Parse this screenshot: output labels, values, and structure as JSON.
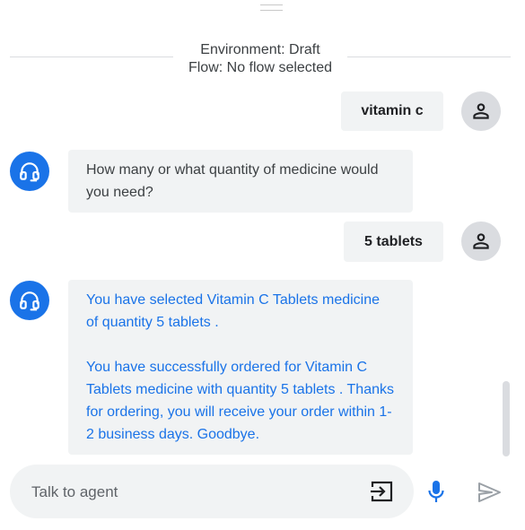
{
  "session": {
    "environment": "Environment: Draft",
    "flow": "Flow: No flow selected"
  },
  "messages": [
    {
      "role": "user",
      "paragraphs": [
        "vitamin c"
      ]
    },
    {
      "role": "agent",
      "paragraphs": [
        "How many or what quantity of medicine would you need?"
      ]
    },
    {
      "role": "user",
      "paragraphs": [
        "5 tablets"
      ]
    },
    {
      "role": "agent",
      "paragraphs": [
        "You have selected Vitamin C Tablets medicine of quantity 5 tablets .",
        "You have successfully ordered for Vitamin C Tablets medicine with quantity 5 tablets . Thanks for ordering, you will receive your order within 1-2 business days. Goodbye."
      ]
    }
  ],
  "input": {
    "placeholder": "Talk to agent",
    "value": ""
  },
  "colors": {
    "accent": "#1a73e8",
    "bubble": "#f1f3f4",
    "user_avatar": "#dadce0",
    "send_disabled": "#9aa0a6"
  },
  "icons": {
    "user_avatar": "person-icon",
    "agent_avatar": "headset-icon",
    "end_session": "exit-icon",
    "mic": "mic-icon",
    "send": "send-icon"
  }
}
